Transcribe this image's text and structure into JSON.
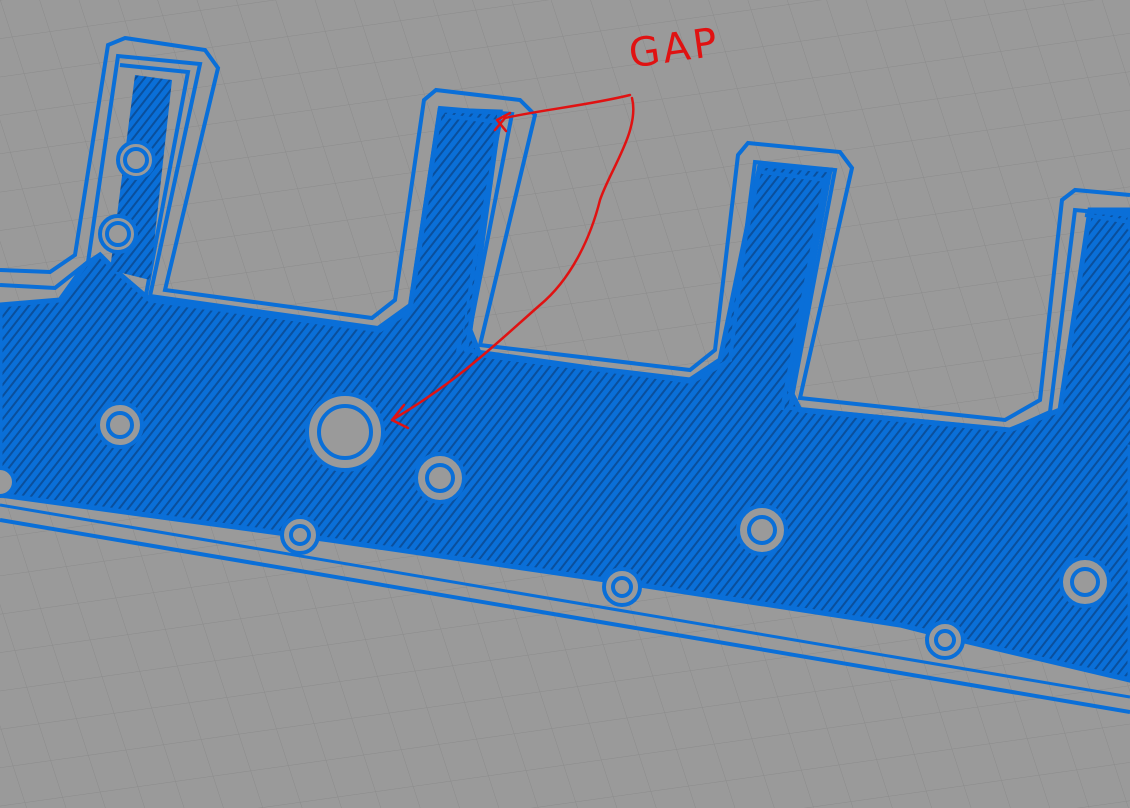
{
  "annotation": {
    "label": "GAP"
  },
  "colors": {
    "build_plate": "#9a9a9a",
    "grid_line": "#8a8a8a",
    "toolpath_blue": "#0a6fd8",
    "toolpath_dark": "#073f86",
    "annotation_red": "#e01212"
  },
  "icons": {
    "annotation_arrow": "arrow-icon"
  }
}
